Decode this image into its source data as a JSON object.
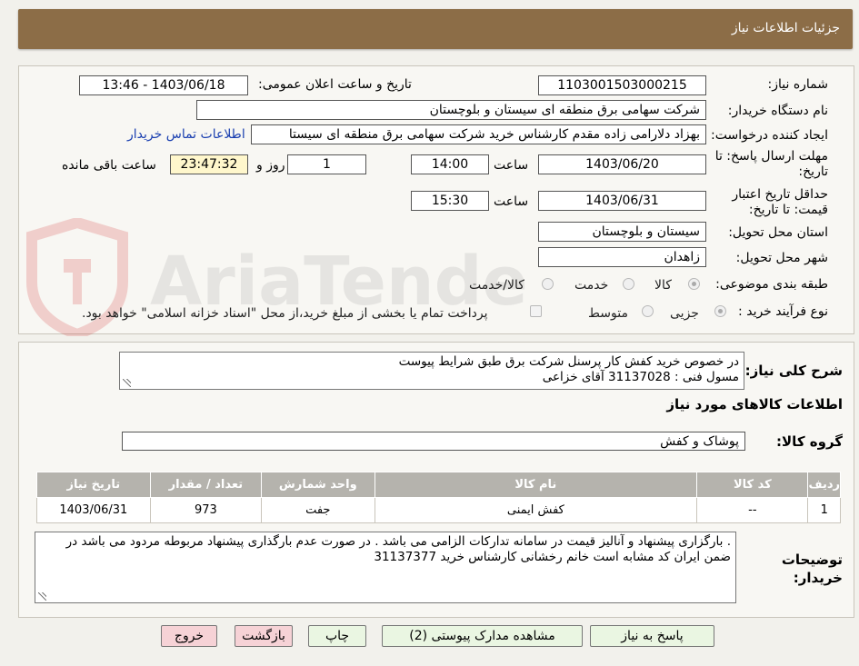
{
  "header": {
    "title": "جزئیات اطلاعات نیاز"
  },
  "form": {
    "need_number_label": "شماره نیاز:",
    "need_number": "1103001503000215",
    "announce_label": "تاریخ و ساعت اعلان عمومی:",
    "announce_value": "1403/06/18 - 13:46",
    "buyer_org_label": "نام دستگاه خریدار:",
    "buyer_org": "شرکت سهامی برق منطقه ای سیستان و بلوچستان",
    "creator_label": "ایجاد کننده درخواست:",
    "creator": "بهزاد  دلارامی زاده مقدم کارشناس خرید شرکت سهامی برق منطقه ای سیستا",
    "contact_link": "اطلاعات تماس خریدار",
    "deadline_label": "مهلت ارسال پاسخ: تا تاریخ:",
    "deadline_date": "1403/06/20",
    "time_label": "ساعت",
    "deadline_time": "14:00",
    "days_value": "1",
    "days_label": "روز و",
    "remaining_time": "23:47:32",
    "remaining_label": "ساعت باقی مانده",
    "validity_label": "حداقل تاریخ اعتبار قیمت: تا تاریخ:",
    "validity_date": "1403/06/31",
    "validity_time": "15:30",
    "province_label": "استان محل تحویل:",
    "province": "سیستان و بلوچستان",
    "city_label": "شهر محل تحویل:",
    "city": "زاهدان",
    "category_label": "طبقه بندی موضوعی:",
    "category_options": [
      "کالا",
      "خدمت",
      "کالا/خدمت"
    ],
    "category_selected": "کالا",
    "process_label": "نوع فرآیند خرید :",
    "process_options": [
      "جزیی",
      "متوسط"
    ],
    "process_selected": "جزیی",
    "treasury_note": "پرداخت تمام یا بخشی از مبلغ خرید،از محل \"اسناد خزانه اسلامی\" خواهد بود."
  },
  "description": {
    "label": "شرح کلی نیاز:",
    "line1": "در خصوص خرید کفش کار پرسنل شرکت برق طبق شرایط پیوست",
    "line2": "مسول فنی : 31137028 آقای خزاعی"
  },
  "goods": {
    "section_title": "اطلاعات کالاهای مورد نیاز",
    "group_label": "گروه کالا:",
    "group_value": "پوشاک و کفش",
    "columns": [
      "ردیف",
      "کد کالا",
      "نام کالا",
      "واحد شمارش",
      "تعداد / مقدار",
      "تاریخ نیاز"
    ],
    "rows": [
      {
        "row": "1",
        "code": "--",
        "name": "کفش ایمنی",
        "unit": "جفت",
        "qty": "973",
        "date": "1403/06/31"
      }
    ]
  },
  "buyer_notes": {
    "label": "توضیحات خریدار:",
    "text": ". بارگزاری پیشنهاد و آنالیز قیمت در سامانه تدارکات الزامی می باشد . در صورت عدم بارگذاری پیشنهاد مربوطه مردود می باشد در ضمن ایران کد مشابه است خانم رخشانی کارشناس خرید 31137377"
  },
  "buttons": {
    "reply": "پاسخ به نیاز",
    "attachments": "مشاهده مدارک پیوستی (2)",
    "print": "چاپ",
    "back": "بازگشت",
    "exit": "خروج"
  },
  "watermark": {
    "text": "AriaTender.neT"
  },
  "colors": {
    "header": "#8c6d47",
    "button_green": "#eaf6e2",
    "button_pink": "#f6d2d6",
    "table_header": "#b5b3ad"
  }
}
